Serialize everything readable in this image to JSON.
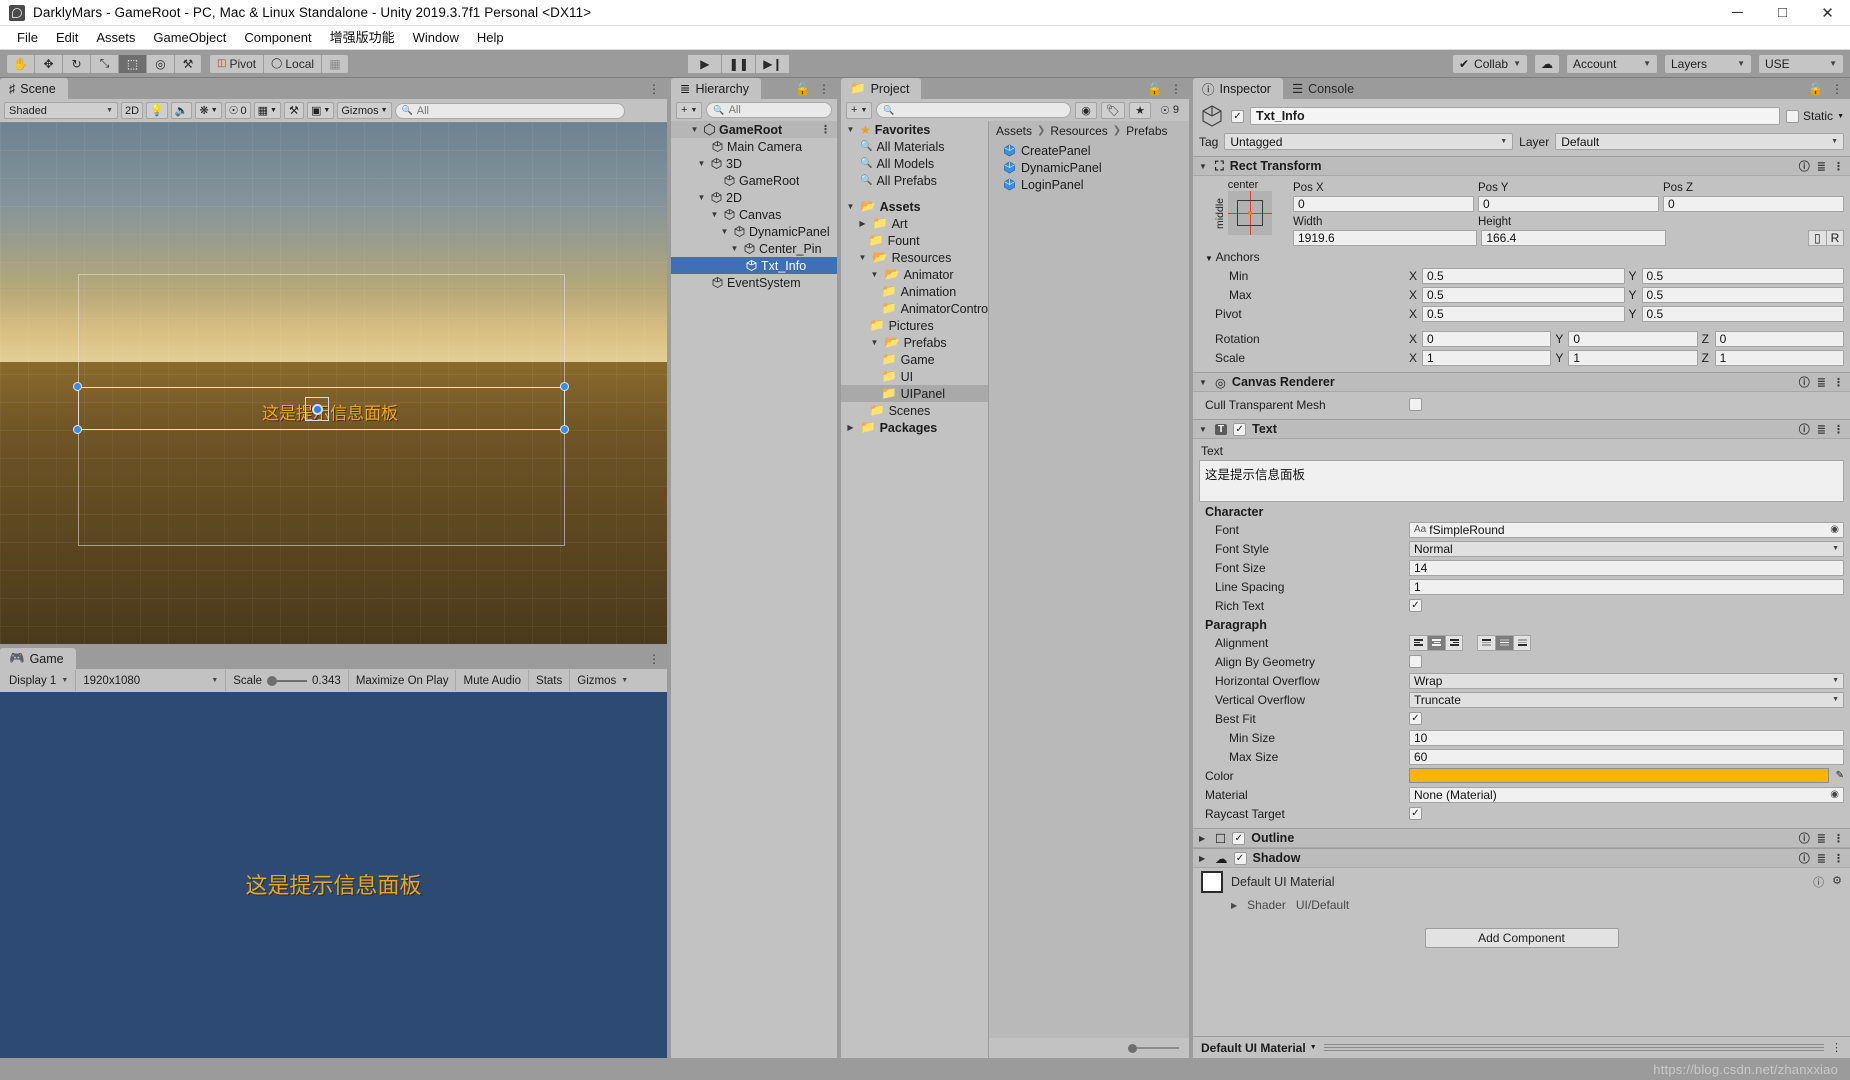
{
  "window": {
    "title": "DarklyMars - GameRoot - PC, Mac & Linux Standalone - Unity 2019.3.7f1 Personal <DX11>",
    "app_icon": "unity-icon",
    "minimize": "─",
    "maximize": "□",
    "close": "✕"
  },
  "menu": {
    "items": [
      "File",
      "Edit",
      "Assets",
      "GameObject",
      "Component",
      "增强版功能",
      "Window",
      "Help"
    ]
  },
  "toolbar": {
    "tools": [
      {
        "name": "hand-tool",
        "glyph": "✋",
        "active": false
      },
      {
        "name": "move-tool",
        "glyph": "✥",
        "active": false
      },
      {
        "name": "rotate-tool",
        "glyph": "↻",
        "active": false
      },
      {
        "name": "scale-tool",
        "glyph": "⤡",
        "active": false
      },
      {
        "name": "rect-tool",
        "glyph": "⬚",
        "active": true
      },
      {
        "name": "transform-tool",
        "glyph": "◎",
        "active": false
      },
      {
        "name": "custom-tool",
        "glyph": "⚒",
        "active": false
      }
    ],
    "pivot_label": "Pivot",
    "local_label": "Local",
    "grid_label": "grid-snap-icon",
    "play": "▶",
    "pause": "❚❚",
    "step": "▶❙",
    "collab_label": "Collab",
    "cloud_label": "cloud-icon",
    "account_label": "Account",
    "layers_label": "Layers",
    "layout_label": "USE"
  },
  "scene": {
    "tab_label": "Scene",
    "tab_icon": "scene-icon",
    "shading_mode": "Shaded",
    "mode_2d": "2D",
    "lighting_icon": "lighting-icon",
    "audio_icon": "audio-icon",
    "fx_icon": "effects-icon",
    "hidden_count": "0",
    "grid_icon": "grid-icon",
    "tools_icon": "tools-icon",
    "camera_icon": "camera-icon",
    "gizmos_label": "Gizmos",
    "search_placeholder": "All",
    "scene_text": "这是提示信息面板"
  },
  "game": {
    "tab_label": "Game",
    "tab_icon": "game-icon",
    "display": "Display 1",
    "resolution": "1920x1080",
    "scale_label": "Scale",
    "scale_value": "0.343",
    "maximize_on_play": "Maximize On Play",
    "mute_audio": "Mute Audio",
    "stats": "Stats",
    "gizmos": "Gizmos",
    "game_text": "这是提示信息面板",
    "background_color": "#2c4a74",
    "text_color": "#e9a81c"
  },
  "hierarchy": {
    "tab_label": "Hierarchy",
    "tab_icon": "hierarchy-icon",
    "add_label": "+",
    "search_placeholder": "All",
    "lock_icon": "lock-icon",
    "menu_icon": "kebab-icon",
    "items": [
      {
        "label": "GameRoot",
        "depth": 0,
        "twisty": "▼",
        "icon": "scene-asset-icon",
        "selected": false,
        "root": true
      },
      {
        "label": "Main Camera",
        "depth": 2,
        "twisty": "",
        "icon": "gameobject-icon",
        "selected": false
      },
      {
        "label": "3D",
        "depth": 1,
        "twisty": "▼",
        "icon": "gameobject-icon",
        "selected": false
      },
      {
        "label": "GameRoot",
        "depth": 2,
        "twisty": "",
        "icon": "gameobject-icon",
        "selected": false
      },
      {
        "label": "2D",
        "depth": 1,
        "twisty": "▼",
        "icon": "gameobject-icon",
        "selected": false
      },
      {
        "label": "Canvas",
        "depth": 2,
        "twisty": "▼",
        "icon": "gameobject-icon",
        "selected": false
      },
      {
        "label": "DynamicPanel",
        "depth": 3,
        "twisty": "▼",
        "icon": "gameobject-icon",
        "selected": false
      },
      {
        "label": "Center_Pin",
        "depth": 4,
        "twisty": "▼",
        "icon": "gameobject-icon",
        "selected": false
      },
      {
        "label": "Txt_Info",
        "depth": 5,
        "twisty": "",
        "icon": "gameobject-icon",
        "selected": true
      },
      {
        "label": "EventSystem",
        "depth": 2,
        "twisty": "",
        "icon": "gameobject-icon",
        "selected": false
      }
    ]
  },
  "project": {
    "tab_label": "Project",
    "tab_icon": "folder-icon",
    "add_label": "+",
    "search_placeholder": "",
    "icon_buttons": [
      "model-filter-icon",
      "label-filter-icon",
      "favorite-filter-icon"
    ],
    "hidden_count": "9",
    "lock_icon": "lock-icon",
    "menu_icon": "kebab-icon",
    "tree": [
      {
        "label": "Favorites",
        "depth": 0,
        "twisty": "▼",
        "icon": "star-icon",
        "bold": true,
        "selected": false
      },
      {
        "label": "All Materials",
        "depth": 1,
        "twisty": "",
        "icon": "search-icon",
        "bold": false,
        "selected": false
      },
      {
        "label": "All Models",
        "depth": 1,
        "twisty": "",
        "icon": "search-icon",
        "bold": false,
        "selected": false
      },
      {
        "label": "All Prefabs",
        "depth": 1,
        "twisty": "",
        "icon": "search-icon",
        "bold": false,
        "selected": false
      },
      {
        "label": "",
        "depth": 0,
        "twisty": "",
        "icon": "spacer",
        "bold": false,
        "selected": false
      },
      {
        "label": "Assets",
        "depth": 0,
        "twisty": "▼",
        "icon": "folder-open-icon",
        "bold": true,
        "selected": false
      },
      {
        "label": "Art",
        "depth": 1,
        "twisty": "▶",
        "icon": "folder-icon",
        "bold": false,
        "selected": false
      },
      {
        "label": "Fount",
        "depth": 1,
        "twisty": "",
        "icon": "folder-icon",
        "bold": false,
        "selected": false
      },
      {
        "label": "Resources",
        "depth": 1,
        "twisty": "▼",
        "icon": "folder-open-icon",
        "bold": false,
        "selected": false
      },
      {
        "label": "Animator",
        "depth": 2,
        "twisty": "▼",
        "icon": "folder-open-icon",
        "bold": false,
        "selected": false
      },
      {
        "label": "Animation",
        "depth": 3,
        "twisty": "",
        "icon": "folder-icon",
        "bold": false,
        "selected": false
      },
      {
        "label": "AnimatorControll",
        "depth": 3,
        "twisty": "",
        "icon": "folder-icon",
        "bold": false,
        "selected": false
      },
      {
        "label": "Pictures",
        "depth": 2,
        "twisty": "",
        "icon": "folder-icon",
        "bold": false,
        "selected": false
      },
      {
        "label": "Prefabs",
        "depth": 2,
        "twisty": "▼",
        "icon": "folder-open-icon",
        "bold": false,
        "selected": false
      },
      {
        "label": "Game",
        "depth": 3,
        "twisty": "",
        "icon": "folder-icon",
        "bold": false,
        "selected": false
      },
      {
        "label": "UI",
        "depth": 3,
        "twisty": "",
        "icon": "folder-icon",
        "bold": false,
        "selected": false
      },
      {
        "label": "UIPanel",
        "depth": 3,
        "twisty": "",
        "icon": "folder-icon",
        "bold": false,
        "selected": true
      },
      {
        "label": "Scenes",
        "depth": 2,
        "twisty": "",
        "icon": "folder-icon",
        "bold": false,
        "selected": false
      },
      {
        "label": "Packages",
        "depth": 0,
        "twisty": "▶",
        "icon": "folder-icon",
        "bold": true,
        "selected": false
      }
    ],
    "breadcrumbs": [
      "Assets",
      "Resources",
      "Prefabs"
    ],
    "assets": [
      {
        "label": "CreatePanel",
        "icon": "prefab-icon"
      },
      {
        "label": "DynamicPanel",
        "icon": "prefab-icon"
      },
      {
        "label": "LoginPanel",
        "icon": "prefab-icon"
      }
    ]
  },
  "inspector": {
    "tab_label": "Inspector",
    "tab_icon": "info-icon",
    "console_tab_label": "Console",
    "console_tab_icon": "console-icon",
    "lock_icon": "lock-icon",
    "menu_icon": "kebab-icon",
    "enabled_check": "✓",
    "object_name": "Txt_Info",
    "static_label": "Static",
    "tag_label": "Tag",
    "tag_value": "Untagged",
    "layer_label": "Layer",
    "layer_value": "Default",
    "rect_transform": {
      "title": "Rect Transform",
      "icon": "rect-transform-icon",
      "anchor_preset_top": "center",
      "anchor_preset_side": "middle",
      "pos_x_label": "Pos X",
      "pos_y_label": "Pos Y",
      "pos_z_label": "Pos Z",
      "pos_x": "0",
      "pos_y": "0",
      "pos_z": "0",
      "width_label": "Width",
      "height_label": "Height",
      "width": "1919.6",
      "height": "166.4",
      "blueprint_icon": "blueprint-icon",
      "raw_label": "R",
      "anchors_label": "Anchors",
      "min_label": "Min",
      "min_x": "0.5",
      "min_y": "0.5",
      "max_label": "Max",
      "max_x": "0.5",
      "max_y": "0.5",
      "pivot_label": "Pivot",
      "pivot_x": "0.5",
      "pivot_y": "0.5",
      "rotation_label": "Rotation",
      "rot_x": "0",
      "rot_y": "0",
      "rot_z": "0",
      "scale_label": "Scale",
      "scale_x": "1",
      "scale_y": "1",
      "scale_z": "1"
    },
    "canvas_renderer": {
      "title": "Canvas Renderer",
      "icon": "canvas-renderer-icon",
      "cull_label": "Cull Transparent Mesh",
      "cull_checked": false
    },
    "text_component": {
      "title": "Text",
      "icon": "text-icon",
      "enabled": true,
      "text_label": "Text",
      "text_value": "这是提示信息面板",
      "character_label": "Character",
      "font_label": "Font",
      "font_value": "fSimpleRound",
      "font_style_label": "Font Style",
      "font_style_value": "Normal",
      "font_size_label": "Font Size",
      "font_size_value": "14",
      "line_spacing_label": "Line Spacing",
      "line_spacing_value": "1",
      "rich_text_label": "Rich Text",
      "rich_text_checked": true,
      "paragraph_label": "Paragraph",
      "alignment_label": "Alignment",
      "align_h_selected": 1,
      "align_v_selected": 1,
      "align_by_geometry_label": "Align By Geometry",
      "align_by_geometry_checked": false,
      "horizontal_overflow_label": "Horizontal Overflow",
      "horizontal_overflow_value": "Wrap",
      "vertical_overflow_label": "Vertical Overflow",
      "vertical_overflow_value": "Truncate",
      "best_fit_label": "Best Fit",
      "best_fit_checked": true,
      "min_size_label": "Min Size",
      "min_size_value": "10",
      "max_size_label": "Max Size",
      "max_size_value": "60",
      "color_label": "Color",
      "color_value": "#f7b500",
      "material_label": "Material",
      "material_value": "None (Material)",
      "raycast_target_label": "Raycast Target",
      "raycast_target_checked": true
    },
    "outline": {
      "title": "Outline",
      "icon": "outline-icon",
      "enabled": true
    },
    "shadow": {
      "title": "Shadow",
      "icon": "shadow-icon",
      "enabled": true
    },
    "material_preview": {
      "name": "Default UI Material",
      "shader_label": "Shader",
      "shader_value": "UI/Default"
    },
    "add_component_label": "Add Component",
    "footer_material": "Default UI Material"
  },
  "status": {
    "watermark": "https://blog.csdn.net/zhanxxiao"
  }
}
